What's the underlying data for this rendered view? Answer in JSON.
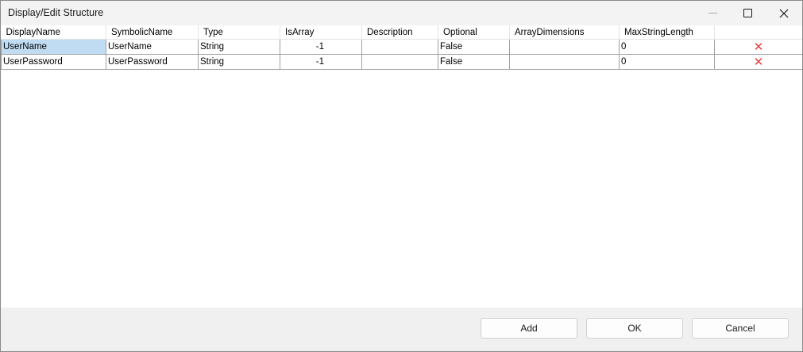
{
  "window": {
    "title": "Display/Edit Structure"
  },
  "grid": {
    "columns": [
      "DisplayName",
      "SymbolicName",
      "Type",
      "IsArray",
      "Description",
      "Optional",
      "ArrayDimensions",
      "MaxStringLength",
      ""
    ],
    "rows": [
      {
        "DisplayName": "UserName",
        "SymbolicName": "UserName",
        "Type": "String",
        "IsArray": "-1",
        "Description": "",
        "Optional": "False",
        "ArrayDimensions": "",
        "MaxStringLength": "0",
        "delete_icon": "✕"
      },
      {
        "DisplayName": "UserPassword",
        "SymbolicName": "UserPassword",
        "Type": "String",
        "IsArray": "-1",
        "Description": "",
        "Optional": "False",
        "ArrayDimensions": "",
        "MaxStringLength": "0",
        "delete_icon": "✕"
      }
    ],
    "selected_cell_color": "#bfdcf3",
    "delete_icon_color": "#e04040"
  },
  "buttons": {
    "add": "Add",
    "ok": "OK",
    "cancel": "Cancel"
  },
  "icons": {
    "minimize": "minimize-icon",
    "maximize": "maximize-icon",
    "close": "close-icon",
    "delete": "delete-row-icon"
  }
}
